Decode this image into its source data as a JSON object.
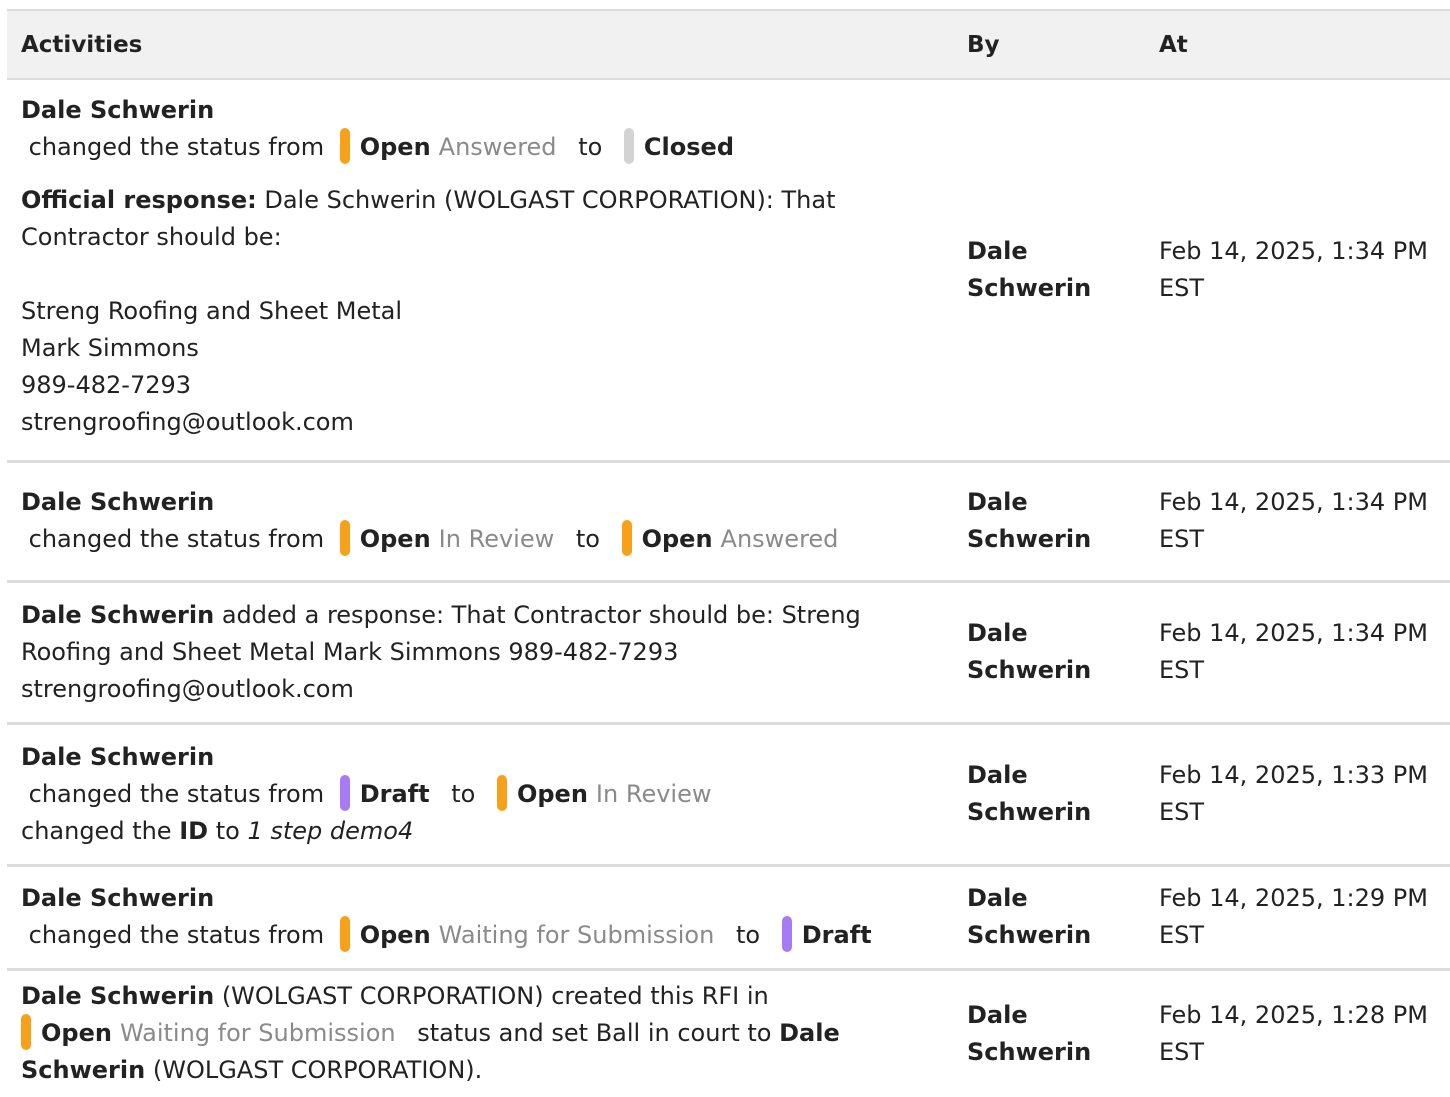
{
  "headers": {
    "activities": "Activities",
    "by": "By",
    "at": "At"
  },
  "colors": {
    "open": "#f7a11a",
    "closed": "#d3d3d3",
    "draft": "#a77bf3"
  },
  "rows": [
    {
      "actor": "Dale Schwerin",
      "changed_text": "changed the status from",
      "from_label": "Open",
      "from_sub": "Answered",
      "to_text": "to",
      "to_label": "Closed",
      "response_label": "Official response:",
      "response_first": "Dale Schwerin (WOLGAST CORPORATION): That Contractor should be:",
      "response_lines": [
        "Streng Roofing and Sheet Metal",
        "Mark Simmons",
        "989-482-7293",
        "strengroofing@outlook.com"
      ],
      "by": "Dale Schwerin",
      "at_date": "Feb 14, 2025, 1:34 PM",
      "at_tz": "EST"
    },
    {
      "actor": "Dale Schwerin",
      "changed_text": "changed the status from",
      "from_label": "Open",
      "from_sub": "In Review",
      "to_text": "to",
      "to_label": "Open",
      "to_sub": "Answered",
      "by": "Dale Schwerin",
      "at_date": "Feb 14, 2025, 1:34 PM",
      "at_tz": "EST"
    },
    {
      "actor": "Dale Schwerin",
      "text": "added a response: That Contractor should be: Streng Roofing and Sheet Metal Mark Simmons 989-482-7293 strengroofing@outlook.com",
      "by": "Dale Schwerin",
      "at_date": "Feb 14, 2025, 1:34 PM",
      "at_tz": "EST"
    },
    {
      "actor": "Dale Schwerin",
      "changed_text": "changed the status from",
      "from_label": "Draft",
      "to_text": "to",
      "to_label": "Open",
      "to_sub": "In Review",
      "id_pre": "changed the",
      "id_label": "ID",
      "id_to": "to",
      "id_value": "1 step demo4",
      "by": "Dale Schwerin",
      "at_date": "Feb 14, 2025, 1:33 PM",
      "at_tz": "EST"
    },
    {
      "actor": "Dale Schwerin",
      "changed_text": "changed the status from",
      "from_label": "Open",
      "from_sub": "Waiting for Submission",
      "to_text": "to",
      "to_label": "Draft",
      "by": "Dale Schwerin",
      "at_date": "Feb 14, 2025, 1:29 PM",
      "at_tz": "EST"
    },
    {
      "actor": "Dale Schwerin",
      "org": "(WOLGAST CORPORATION) created this RFI in",
      "status_label": "Open",
      "status_sub": "Waiting for Submission",
      "mid_text": "status and set Ball in court to",
      "ball_name": "Dale Schwerin",
      "ball_org": "(WOLGAST CORPORATION).",
      "by": "Dale Schwerin",
      "at_date": "Feb 14, 2025, 1:28 PM",
      "at_tz": "EST"
    }
  ]
}
